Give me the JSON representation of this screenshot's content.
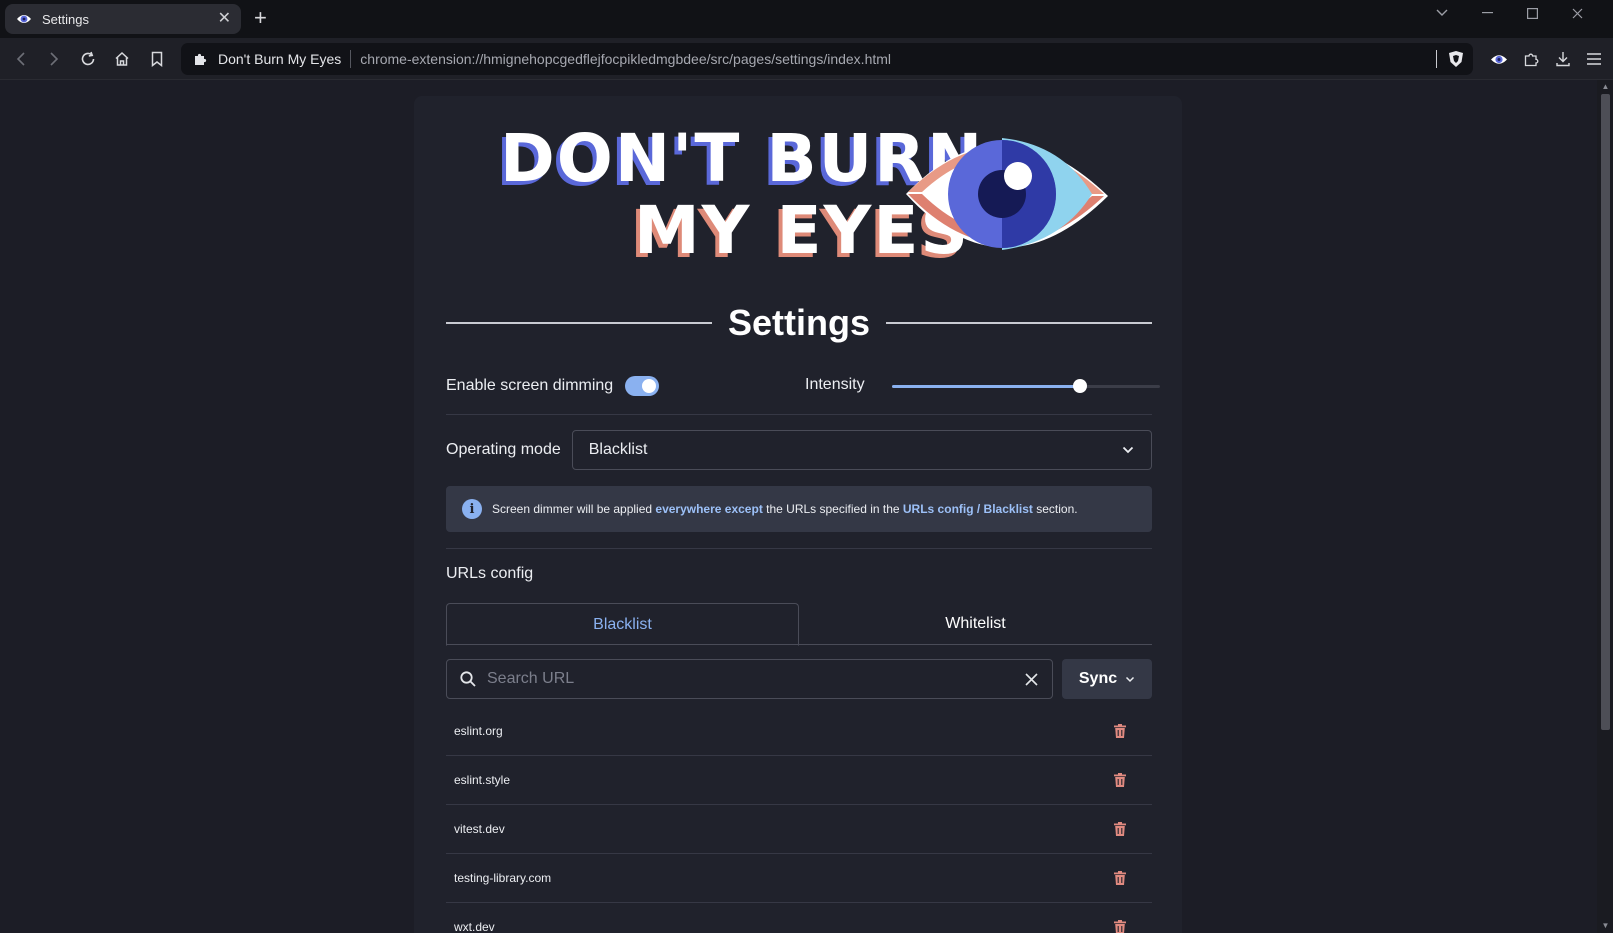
{
  "browser": {
    "tab_title": "Settings",
    "omnibox": {
      "site_name": "Don't Burn My Eyes",
      "url": "chrome-extension://hmignehopcgedflejfocpikledmgbdee/src/pages/settings/index.html"
    },
    "icons": [
      "eye-favicon-icon",
      "close-icon",
      "plus-icon",
      "chevron-down-icon",
      "minimize-icon",
      "maximize-icon",
      "window-close-icon",
      "back-icon",
      "forward-icon",
      "reload-icon",
      "home-icon",
      "bookmark-icon",
      "puzzle-icon",
      "brave-shield-icon",
      "download-icon",
      "menu-icon"
    ]
  },
  "logo": {
    "line1": "DON'T BURN",
    "line2": "MY EYES"
  },
  "settings": {
    "heading": "Settings",
    "enable_dimming_label": "Enable screen dimming",
    "dimming_enabled": true,
    "intensity_label": "Intensity",
    "intensity_value": 0.7,
    "operating_mode_label": "Operating mode",
    "operating_mode_value": "Blacklist",
    "info": {
      "prefix": "Screen dimmer will be applied ",
      "emphasis": "everywhere except",
      "middle": " the URLs specified in the ",
      "link": "URLs config / Blacklist",
      "suffix": " section."
    }
  },
  "urls_config": {
    "title": "URLs config",
    "tabs": [
      {
        "label": "Blacklist",
        "active": true
      },
      {
        "label": "Whitelist",
        "active": false
      }
    ],
    "search_placeholder": "Search URL",
    "sync_label": "Sync",
    "urls": [
      "eslint.org",
      "eslint.style",
      "vitest.dev",
      "testing-library.com",
      "wxt.dev"
    ]
  },
  "colors": {
    "accent": "#8ab1f0",
    "delete": "#e08a80",
    "background": "#1c1d26",
    "card": "#20222c"
  }
}
